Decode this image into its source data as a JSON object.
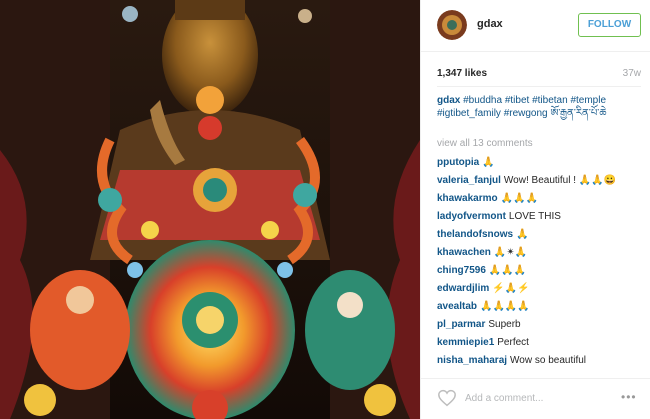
{
  "post": {
    "image_alt": "Golden Buddha statue with colorful Tibetan butter sculptures",
    "username": "gdax",
    "follow_label": "FOLLOW",
    "likes": "1,347 likes",
    "age": "37w"
  },
  "caption": {
    "username": "gdax",
    "text": "#buddha #tibet #tibetan #temple #igtibet_family #rewgong ཨོ་རྒྱན་རིན་པོ་ཆེ"
  },
  "view_all": "view all 13 comments",
  "comments": [
    {
      "user": "pputopia",
      "text": "🙏"
    },
    {
      "user": "valeria_fanjul",
      "text": "Wow! Beautiful ! 🙏🙏😀"
    },
    {
      "user": "khawakarmo",
      "text": "🙏🙏🙏"
    },
    {
      "user": "ladyofvermont",
      "text": "LOVE THIS"
    },
    {
      "user": "thelandofsnows",
      "text": "🙏"
    },
    {
      "user": "khawachen",
      "text": "🙏✴🙏"
    },
    {
      "user": "ching7596",
      "text": "🙏🙏🙏"
    },
    {
      "user": "edwardjlim",
      "text": "⚡🙏⚡"
    },
    {
      "user": "avealtab",
      "text": "🙏🙏🙏🙏"
    },
    {
      "user": "pl_parmar",
      "text": "Superb"
    },
    {
      "user": "kemmiepie1",
      "text": "Perfect"
    },
    {
      "user": "nisha_maharaj",
      "text": "Wow so beautiful"
    }
  ],
  "comment_box": {
    "placeholder": "Add a comment..."
  },
  "icons": {
    "like": "heart-outline-icon",
    "more": "more-options-icon"
  },
  "colors": {
    "link": "#125688",
    "follow_border": "#70c050",
    "follow_text": "#4a9fd6",
    "muted": "#a5a7aa"
  }
}
